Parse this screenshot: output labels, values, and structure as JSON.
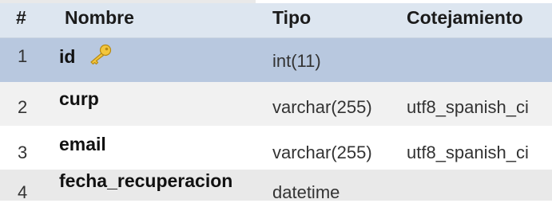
{
  "columns": {
    "index": "#",
    "name": "Nombre",
    "type": "Tipo",
    "collation": "Cotejamiento"
  },
  "rows": [
    {
      "index": "1",
      "name": "id",
      "type": "int(11)",
      "collation": "",
      "primary_key_icon": "key-icon"
    },
    {
      "index": "2",
      "name": "curp",
      "type": "varchar(255)",
      "collation": "utf8_spanish_ci"
    },
    {
      "index": "3",
      "name": "email",
      "type": "varchar(255)",
      "collation": "utf8_spanish_ci"
    },
    {
      "index": "4",
      "name": "fecha_recuperacion",
      "type": "datetime",
      "collation": ""
    }
  ],
  "colors": {
    "header_bg": "#dde6f0",
    "selected_row_bg": "#b8c8df",
    "even_row_bg": "#f1f1f1",
    "odd_row_bg": "#ffffff",
    "key_icon": "#f0c23a"
  }
}
